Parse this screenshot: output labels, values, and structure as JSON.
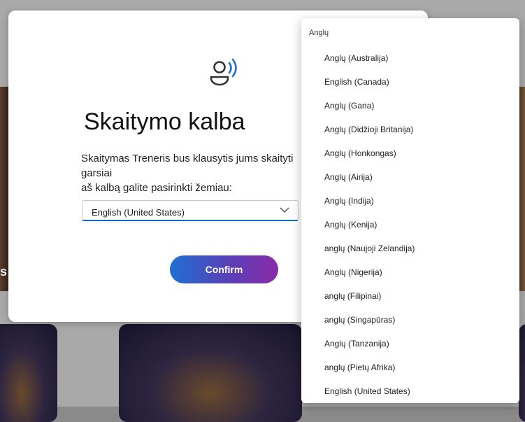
{
  "background": {
    "partial_text": "s"
  },
  "dialog": {
    "title": "Skaitymo kalba",
    "description": "Skaitymas Treneris bus klausytis jums skaityti garsiai\naš kalbą galite pasirinkti žemiau:",
    "select_value": "English (United States)",
    "confirm_label": "Confirm",
    "icon": "speaker-person-icon",
    "accent_color": "#0f6cbd"
  },
  "dropdown": {
    "group_label": "Anglų",
    "options": [
      "Anglų (Australija)",
      "English (Canada)",
      "Anglų (Gana)",
      "Anglų (Didžioji Britanija)",
      "Anglų (Honkongas)",
      "Anglų (Airija)",
      "Anglų (Indija)",
      "Anglų (Kenija)",
      "anglų (Naujoji Zelandija)",
      "Anglų (Nigerija)",
      "anglų (Filipinai)",
      "anglų (Singapūras)",
      "Anglų (Tanzanija)",
      "anglų (Pietų Afrika)",
      "English (United States)"
    ]
  }
}
